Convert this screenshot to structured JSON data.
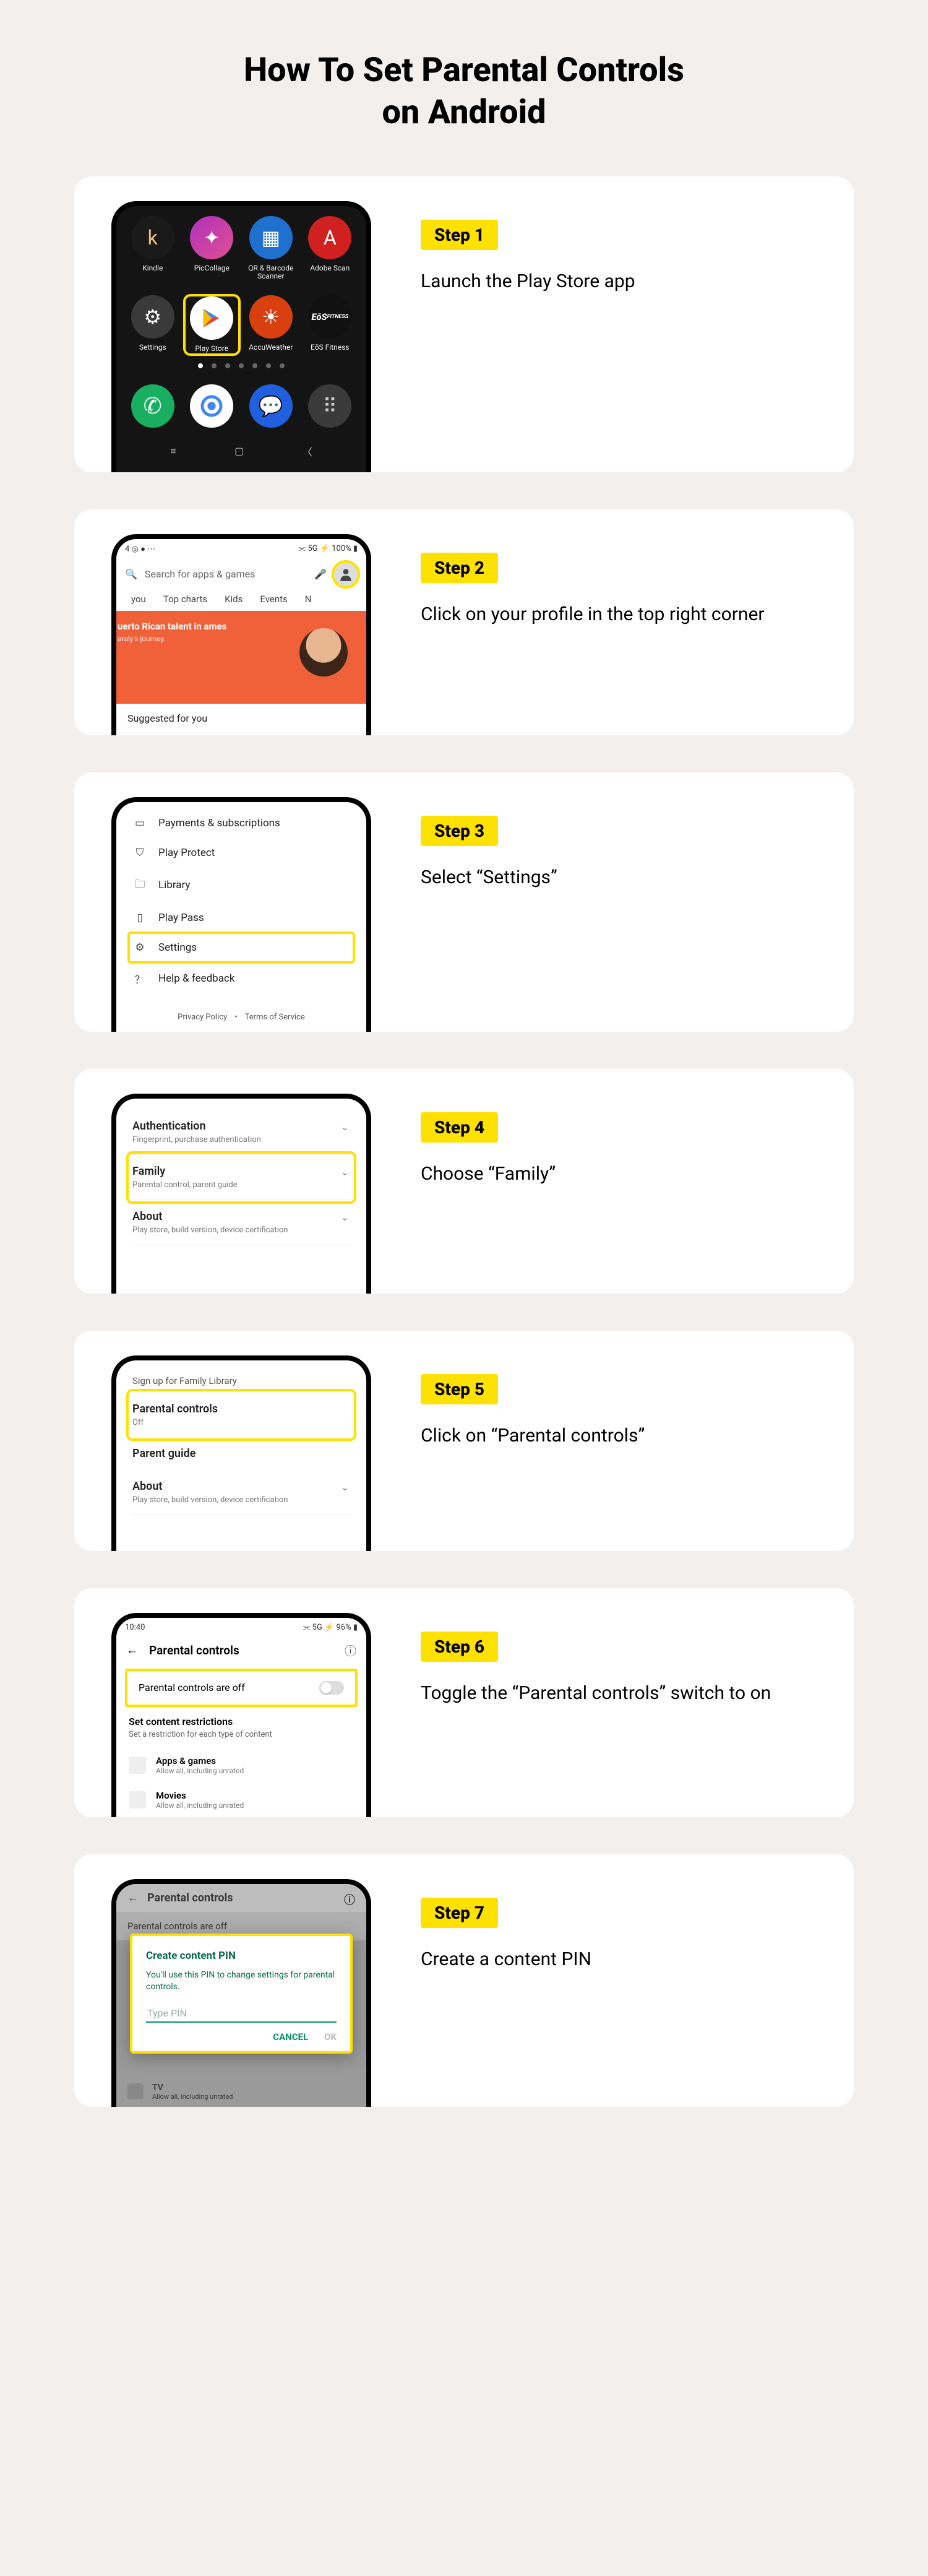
{
  "title_l1": "How To Set Parental Controls",
  "title_l2": "on Android",
  "steps": [
    {
      "badge": "Step 1",
      "desc": "Launch the Play Store app"
    },
    {
      "badge": "Step 2",
      "desc": "Click on your profile in the top right corner"
    },
    {
      "badge": "Step 3",
      "desc": "Select “Settings”"
    },
    {
      "badge": "Step 4",
      "desc": "Choose “Family”"
    },
    {
      "badge": "Step 5",
      "desc": "Click on “Parental controls”"
    },
    {
      "badge": "Step 6",
      "desc": "Toggle the “Parental controls” switch to on"
    },
    {
      "badge": "Step 7",
      "desc": "Create a content PIN"
    }
  ],
  "s1": {
    "apps_row1": [
      "Kindle",
      "PicCollage",
      "QR & Barcode Scanner",
      "Adobe Scan"
    ],
    "apps_row2": [
      "Settings",
      "Play Store",
      "AccuWeather",
      "EōS Fitness"
    ]
  },
  "s2": {
    "battery": "100%",
    "search_placeholder": "Search for apps & games",
    "tabs": [
      "you",
      "Top charts",
      "Kids",
      "Events",
      "N"
    ],
    "banner_title": "uerto Rican talent in ames",
    "banner_sub": "araly's journey.",
    "suggested": "Suggested for you"
  },
  "s3": {
    "items": [
      "Payments & subscriptions",
      "Play Protect",
      "Library",
      "Play Pass",
      "Settings",
      "Help & feedback"
    ],
    "policy_l": "Privacy Policy",
    "policy_r": "Terms of Service"
  },
  "s4": {
    "rows": [
      {
        "t": "Authentication",
        "s": "Fingerprint, purchase authentication"
      },
      {
        "t": "Family",
        "s": "Parental control, parent guide"
      },
      {
        "t": "About",
        "s": "Play store, build version, device certification"
      }
    ]
  },
  "s5": {
    "head": "Sign up for Family Library",
    "rows": [
      {
        "t": "Parental controls",
        "s": "Off"
      },
      {
        "t": "Parent guide",
        "s": ""
      },
      {
        "t": "About",
        "s": "Play store, build version, device certification"
      }
    ]
  },
  "s6": {
    "time": "10:40",
    "batt": "96%",
    "title": "Parental controls",
    "toggle_label": "Parental controls are off",
    "sec_t": "Set content restrictions",
    "sec_s": "Set a restriction for each type of content",
    "cats": [
      {
        "t": "Apps & games",
        "s": "Allow all, including unrated"
      },
      {
        "t": "Movies",
        "s": "Allow all, including unrated"
      }
    ]
  },
  "s7": {
    "title": "Parental controls",
    "dim_label": "Parental controls are off",
    "modal_t": "Create content PIN",
    "modal_s": "You'll use this PIN to change settings for parental controls.",
    "pin_ph": "Type PIN",
    "cancel": "CANCEL",
    "ok": "OK",
    "cat": {
      "t": "TV",
      "s": "Allow all, including unrated"
    }
  }
}
